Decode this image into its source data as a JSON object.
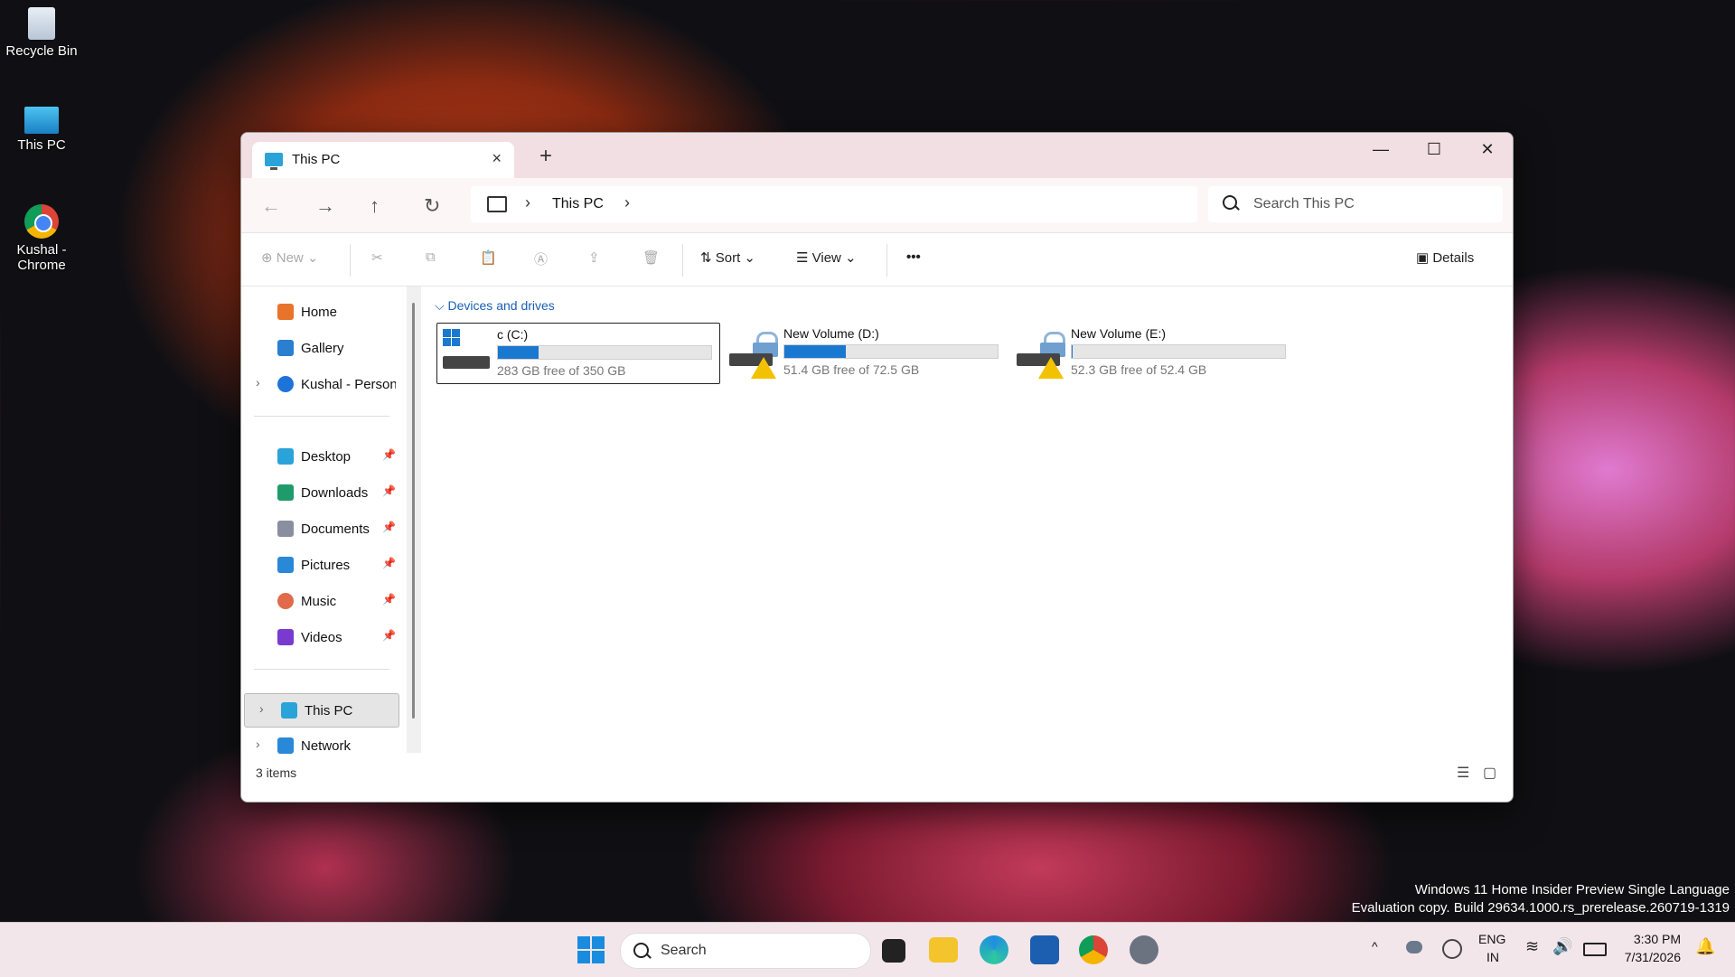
{
  "desktop": {
    "icons": [
      {
        "label": "Recycle Bin",
        "icon": "recycle-bin-icon"
      },
      {
        "label": "This PC",
        "icon": "monitor-icon"
      },
      {
        "label": "Kushal - Chrome",
        "icon": "chrome-icon"
      }
    ],
    "watermark_line1": "Windows 11 Home Insider Preview Single Language",
    "watermark_line2": "Evaluation copy. Build 29634.1000.rs_prerelease.260719-1319"
  },
  "window": {
    "tab_title": "This PC",
    "tab_close": "×",
    "tab_add": "+",
    "controls": {
      "minimize": "—",
      "maximize": "☐",
      "close": "✕"
    },
    "nav": {
      "back": "←",
      "forward": "→",
      "up": "↑",
      "refresh": "↻"
    },
    "breadcrumb": {
      "sep1": "›",
      "location": "This PC",
      "sep2": "›"
    },
    "search_placeholder": "Search This PC",
    "toolbar": {
      "new": "New",
      "sort": "Sort",
      "view": "View",
      "more": "•••",
      "details": "Details"
    },
    "sidebar": {
      "quick": [
        {
          "label": "Home",
          "icon": "home-icon",
          "color": "#e8732a"
        },
        {
          "label": "Gallery",
          "icon": "gallery-icon",
          "color": "#2a7fd0"
        },
        {
          "label": "Kushal - Persona",
          "icon": "onedrive-icon",
          "color": "#1e73d8"
        }
      ],
      "pinned": [
        {
          "label": "Desktop",
          "icon": "desktop-icon",
          "color": "#2aa3d8"
        },
        {
          "label": "Downloads",
          "icon": "downloads-icon",
          "color": "#1f9b6b"
        },
        {
          "label": "Documents",
          "icon": "documents-icon",
          "color": "#8a8fa0"
        },
        {
          "label": "Pictures",
          "icon": "pictures-icon",
          "color": "#2a88d8"
        },
        {
          "label": "Music",
          "icon": "music-icon",
          "color": "#e06a4a"
        },
        {
          "label": "Videos",
          "icon": "videos-icon",
          "color": "#7a3ad0"
        }
      ],
      "bottom": [
        {
          "label": "This PC",
          "icon": "this-pc-icon",
          "color": "#2aa3d8"
        },
        {
          "label": "Network",
          "icon": "network-icon",
          "color": "#2a88d8"
        }
      ]
    },
    "group_header": "Devices and drives",
    "group_chevron": "⌵",
    "drives": [
      {
        "name": "c (C:)",
        "free": "283 GB free of 350 GB",
        "used_fraction": 0.19,
        "warning": false
      },
      {
        "name": "New Volume (D:)",
        "free": "51.4 GB free of 72.5 GB",
        "used_fraction": 0.29,
        "warning": true
      },
      {
        "name": "New Volume (E:)",
        "free": "52.3 GB free of 52.4 GB",
        "used_fraction": 0.002,
        "warning": true
      }
    ],
    "status": "3 items"
  },
  "taskbar": {
    "search_label": "Search",
    "tray": {
      "lang1": "ENG",
      "lang2": "IN",
      "time": "3:30 PM",
      "date": "7/31/2026",
      "chevron": "^"
    }
  },
  "colors": {
    "accent": "#1a78d0",
    "warning": "#f2c200",
    "titlebar": "#f2dfe3"
  }
}
